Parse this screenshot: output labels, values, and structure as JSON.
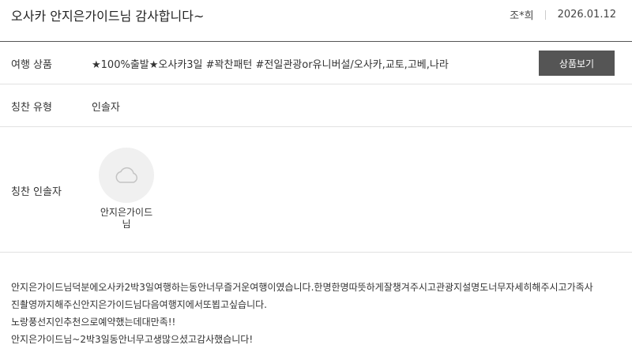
{
  "review": {
    "title": "오사카 안지은가이드님 감사합니다~",
    "author": "조*희",
    "date": "2026.01.12"
  },
  "product": {
    "label": "여행 상품",
    "name": "★100%출발★오사카3일 #꽉찬패턴 #전일관광or유니버설/오사카,교토,고베,나라",
    "button_label": "상품보기"
  },
  "praise_type": {
    "label": "칭찬 유형",
    "value": "인솔자"
  },
  "praise_guide": {
    "label": "칭찬 인솔자",
    "avatar_icon": "cloud-icon",
    "name_line1": "안지은가이드",
    "name_line2": "님"
  },
  "content": {
    "lines": [
      "안지은가이드님덕분에오사카2박3일여행하는동안너무즐거운여행이였습니다.한명한명따뜻하게잘챙겨주시고관광지설명도너무자세히해주시고가족사",
      "진촬영까지해주신안지은가이드님다음여행지에서또뵙고싶습니다.",
      "노랑풍선지인추천으로예약했는데대만족!!",
      "안지은가이드님~2박3일동안너무고생많으셨고감사했습니다!"
    ]
  },
  "colors": {
    "button_bg": "#555555",
    "avatar_bg": "#f0f0f0",
    "divider": "#e2e2e2"
  }
}
